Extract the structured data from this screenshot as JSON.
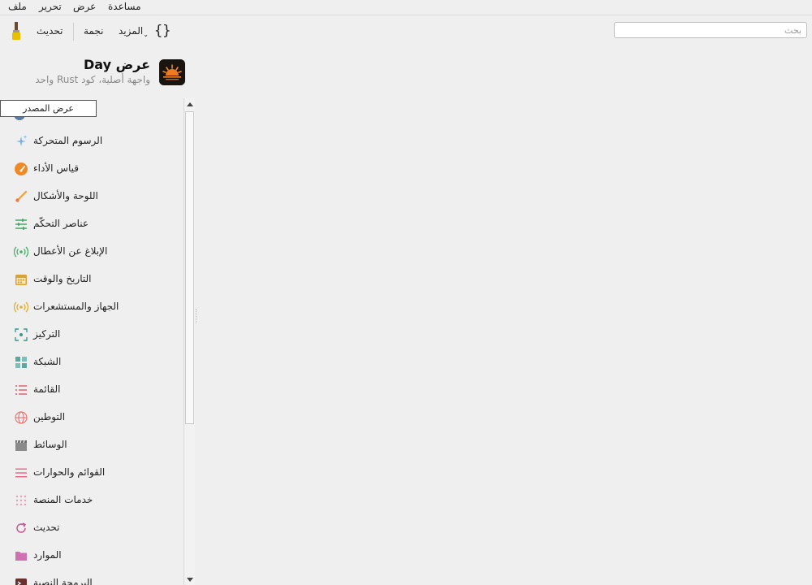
{
  "menubar": {
    "items": [
      "ملف",
      "تحرير",
      "عرض",
      "مساعدة"
    ]
  },
  "toolbar": {
    "refresh_label": "تحديث",
    "star_label": "نجمة",
    "more_label": "المزيد",
    "braces_label": "{}",
    "search_placeholder": "بحث"
  },
  "header": {
    "title": "عرض Day",
    "subtitle": "واجهة أصلية، كود Rust واحد"
  },
  "tooltip": {
    "text": "عرض المصدر"
  },
  "sidebar": {
    "items": [
      {
        "label": "الرسوم المتحركة",
        "icon": "sparkles-icon",
        "color": "#6aa7e6"
      },
      {
        "label": "قياس الأداء",
        "icon": "gauge-icon",
        "color": "#f08a24"
      },
      {
        "label": "اللوحة والأشكال",
        "icon": "brush-icon",
        "color": "#f0a040"
      },
      {
        "label": "عناصر التحكّم",
        "icon": "sliders-icon",
        "color": "#3aa060"
      },
      {
        "label": "الإبلاغ عن الأعطال",
        "icon": "signal-icon",
        "color": "#4aae6a"
      },
      {
        "label": "التاريخ والوقت",
        "icon": "calendar-icon",
        "color": "#d8a23a"
      },
      {
        "label": "الجهاز والمستشعرات",
        "icon": "radar-icon",
        "color": "#e0b030"
      },
      {
        "label": "التركيز",
        "icon": "focus-icon",
        "color": "#3a9a8a"
      },
      {
        "label": "الشبكة",
        "icon": "grid-icon",
        "color": "#5aa8a0"
      },
      {
        "label": "القائمة",
        "icon": "list-icon",
        "color": "#e05a6a"
      },
      {
        "label": "التوطين",
        "icon": "globe-icon",
        "color": "#e87a7a"
      },
      {
        "label": "الوسائط",
        "icon": "clapper-icon",
        "color": "#8a8a8a"
      },
      {
        "label": "القوائم والحوارات",
        "icon": "menu-icon",
        "color": "#e86a8a"
      },
      {
        "label": "خدمات المنصة",
        "icon": "dots-grid-icon",
        "color": "#e8a0b0"
      },
      {
        "label": "تحديث",
        "icon": "refresh-icon",
        "color": "#c05a90"
      },
      {
        "label": "الموارد",
        "icon": "folder-icon",
        "color": "#d070b0"
      },
      {
        "label": "البرمجة النصية",
        "icon": "terminal-icon",
        "color": "#a04040"
      }
    ]
  }
}
